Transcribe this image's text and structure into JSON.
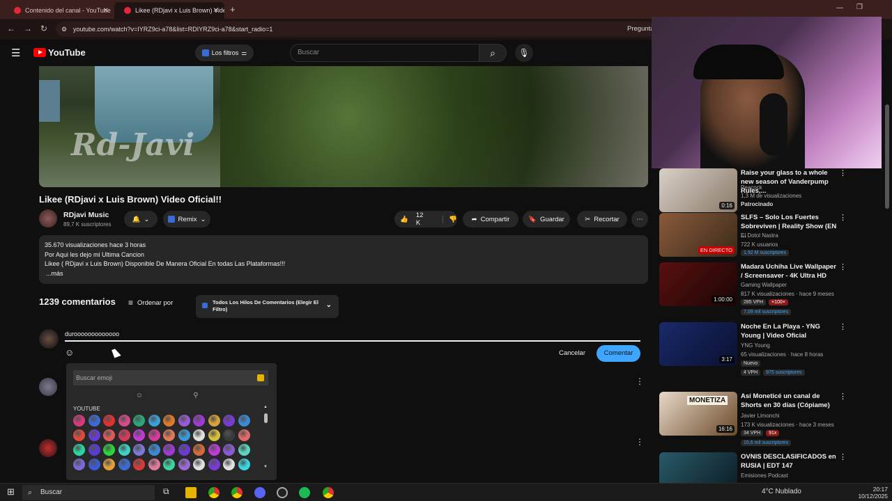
{
  "browser": {
    "tabs": [
      {
        "label": "Contenido del canal - YouTube"
      },
      {
        "label": "Likee (RDjavi x Luis Brown) Vide"
      }
    ],
    "new_tab": "+",
    "url": "youtube.com/watch?v=IYRZ9ci-a78&list=RDIYRZ9ci-a78&start_radio=1",
    "right_label": "Pregunta"
  },
  "header": {
    "logo": "YouTube",
    "filters": "Los filtros",
    "search_placeholder": "Buscar"
  },
  "video": {
    "watermark": "Rd-Javi",
    "title": "Likee (RDjavi x Luis Brown) Video Oficial!!",
    "channel": "RDjavi Music",
    "subscribers": "89,7 K suscriptores",
    "remix": "Remix",
    "likes": "12 K",
    "share": "Compartir",
    "save": "Guardar",
    "clip": "Recortar"
  },
  "description": {
    "stats": "35.670 visualizaciones  hace 3 horas",
    "line1": "Por Aqui les dejo mi Ultima Cancion",
    "line2": "Likee ( RDjavi x Luis Brown) Disponible De Manera Oficial En todas Las Plataformas!!!",
    "more": "...más"
  },
  "comments": {
    "count": "1239 comentarios",
    "sort": "Ordenar por",
    "thread_filter": "Todos Los Hilos De Comentarios (Elegir El Filtro)",
    "input_value": "durooooooooooooo",
    "cancel": "Cancelar",
    "submit": "Comentar"
  },
  "emoji_picker": {
    "search_placeholder": "Buscar emoji",
    "category": "YOUTUBE",
    "emoji_colors": [
      "#d63a7a",
      "#3a6ad6",
      "#e03030",
      "#d64a8a",
      "#2aa87a",
      "#3aa0d6",
      "#e07a2a",
      "#9a5ad6",
      "#a03ad6",
      "#d6a03a",
      "#7a3ad6",
      "#3a8ad6",
      "#e04a3a",
      "#6a3ad6",
      "#e05a5a",
      "#d63a5a",
      "#c03ad6",
      "#d63a9a",
      "#e07a5a",
      "#3a9ad6",
      "#e0e0e0",
      "#d6c03a",
      "#3a3a3a",
      "#e06a6a",
      "#2ad6a0",
      "#5a3ad6",
      "#2ad63a",
      "#3ad6c0",
      "#7a7ad6",
      "#3a8ad6",
      "#a03ad6",
      "#6a3ad6",
      "#d66a3a",
      "#c03ad6",
      "#8a5ad6",
      "#5ad6c0",
      "#7a6ad6",
      "#3a5ad6",
      "#e0a03a",
      "#3a6ad6",
      "#d63a3a",
      "#e07a9a",
      "#3ad6a0",
      "#9a6ad6",
      "#e0e0e0",
      "#7a3ad6",
      "#e0e0e0",
      "#3ad6e0"
    ]
  },
  "sidebar": {
    "videos": [
      {
        "title": "Raise your glass to a whole new season of Vanderpump Rules,...",
        "channel": "Peacock",
        "meta": "1,3 M de visualizaciones",
        "extra": "Patrocinado",
        "duration": "0:16"
      },
      {
        "title": "SLFS – Solo Los Fuertes Sobreviven | Reality Show (EN ...",
        "channel": "El Dotol Nastra",
        "meta": "722 K usuarios",
        "badge": "EN DIRECTO",
        "tags": [
          "1,92 M suscriptores"
        ]
      },
      {
        "title": "Madara Uchiha Live Wallpaper / Screensaver - 4K Ultra HD",
        "channel": "Gaming Wallpaper",
        "meta": "817 K visualizaciones · hace 9 meses",
        "duration": "1:00:00",
        "tags": [
          "285 VPH",
          "×100×",
          "7,09 mil suscriptores"
        ]
      },
      {
        "title": "Noche En La Playa - YNG Young | Video Oficial",
        "channel": "YNG Young",
        "meta": "65 visualizaciones · hace 8 horas",
        "extra": "Nuevo",
        "duration": "3:17",
        "tags": [
          "4 VPH",
          "875 suscriptores"
        ]
      },
      {
        "title": "Así Moneticé un canal de Shorts en 30 días (Cópiame)",
        "channel": "Javier Limonchi",
        "meta": "173 K visualizaciones · hace 3 meses",
        "duration": "16:16",
        "tags": [
          "34 VPH",
          "91x",
          "15,6 mil suscriptores"
        ]
      },
      {
        "title": "OVNIS DESCLASIFICADOS en RUSIA | EDT 147",
        "channel": "Emisiones Podcast",
        "meta": ""
      }
    ]
  },
  "taskbar": {
    "search": "Buscar",
    "weather": "4°C  Nublado",
    "time": "20:17",
    "date": "10/12/2025"
  }
}
